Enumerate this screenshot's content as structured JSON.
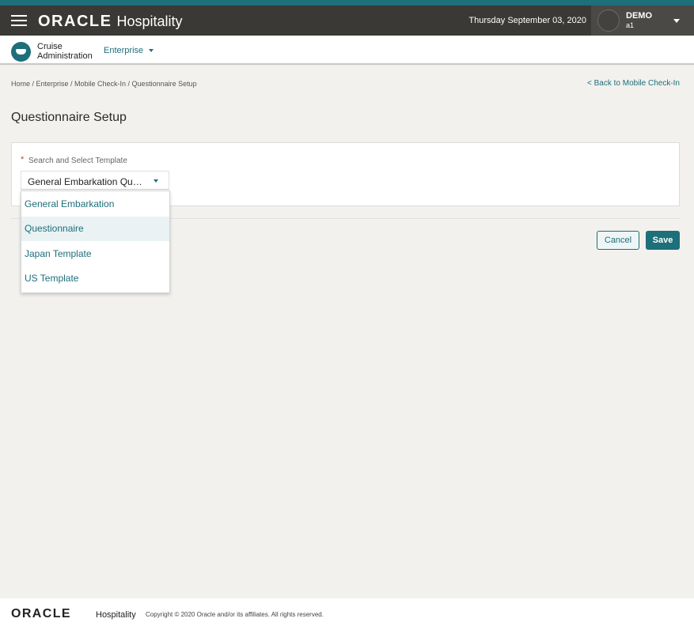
{
  "header": {
    "brand_oracle": "ORACLE",
    "brand_product": "Hospitality",
    "date": "Thursday September 03, 2020",
    "user_name": "DEMO",
    "user_sub": "a1"
  },
  "subheader": {
    "app_line1": "Cruise",
    "app_line2": "Administration",
    "enterprise_label": "Enterprise"
  },
  "breadcrumb": "Home / Enterprise / Mobile Check-In / Questionnaire Setup",
  "back_link": "< Back to Mobile Check-In",
  "page_title": "Questionnaire Setup",
  "form": {
    "required_mark": "*",
    "template_label": "Search and Select Template",
    "template_value": "General Embarkation Qu…",
    "options": [
      "General Embarkation",
      "Questionnaire",
      "Japan Template",
      "US Template"
    ],
    "hovered_option": "Questionnaire"
  },
  "buttons": {
    "cancel": "Cancel",
    "save": "Save"
  },
  "footer": {
    "oracle": "ORACLE",
    "product": "Hospitality",
    "copyright": "Copyright © 2020 Oracle and/or its affiliates. All rights reserved."
  },
  "colors": {
    "accent": "#1d6f7a",
    "header_bg": "#3a3935",
    "page_bg": "#f2f1ee",
    "required": "#c74634"
  }
}
